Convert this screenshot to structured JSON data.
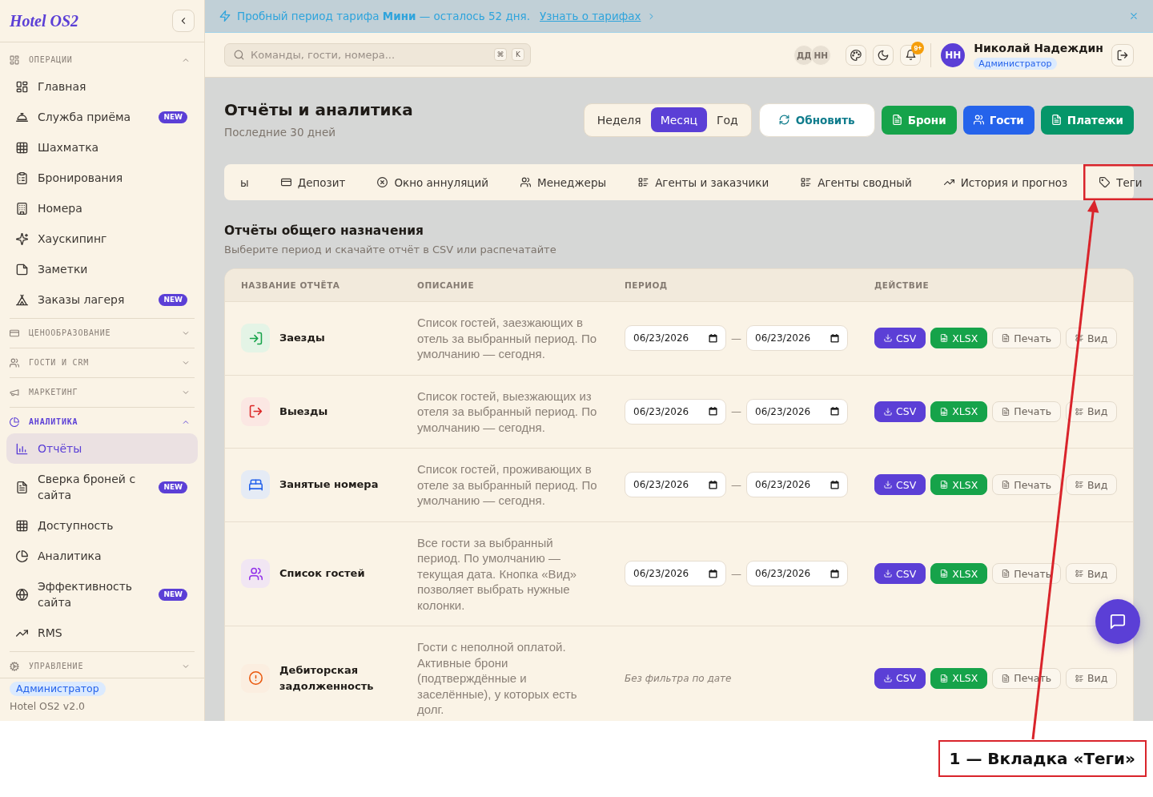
{
  "sidebar": {
    "logo": "Hotel OS2",
    "sections": [
      {
        "title": "ОПЕРАЦИИ",
        "expanded": true,
        "active": false,
        "items": [
          {
            "label": "Главная",
            "selected": false
          },
          {
            "label": "Служба приёма",
            "badge": "NEW",
            "selected": false
          },
          {
            "label": "Шахматка",
            "selected": false
          },
          {
            "label": "Бронирования",
            "selected": false
          },
          {
            "label": "Номера",
            "selected": false
          },
          {
            "label": "Хаускипинг",
            "selected": false
          },
          {
            "label": "Заметки",
            "selected": false
          },
          {
            "label": "Заказы лагеря",
            "badge": "NEW",
            "selected": false
          }
        ]
      },
      {
        "title": "ЦЕНООБРАЗОВАНИЕ",
        "expanded": false,
        "active": false
      },
      {
        "title": "ГОСТИ И CRM",
        "expanded": false,
        "active": false
      },
      {
        "title": "МАРКЕТИНГ",
        "expanded": false,
        "active": false
      },
      {
        "title": "АНАЛИТИКА",
        "expanded": true,
        "active": true,
        "items": [
          {
            "label": "Отчёты",
            "selected": true
          },
          {
            "label": "Сверка броней с сайта",
            "badge": "NEW",
            "selected": false
          },
          {
            "label": "Доступность",
            "selected": false
          },
          {
            "label": "Аналитика",
            "selected": false
          },
          {
            "label": "Эффективность сайта",
            "badge": "NEW",
            "selected": false
          },
          {
            "label": "RMS",
            "selected": false
          }
        ]
      },
      {
        "title": "УПРАВЛЕНИЕ",
        "expanded": false,
        "active": false
      }
    ],
    "footer": {
      "role": "Администратор",
      "version": "Hotel OS2 v2.0"
    }
  },
  "banner": {
    "text": "Пробный период тарифа **Мини** — осталось 52 дня.",
    "link": "Узнать о тарифах"
  },
  "topbar": {
    "search": {
      "placeholder": "Команды, гости, номера..."
    },
    "shortcut": [
      "⌘",
      "K"
    ],
    "presence": [
      "ДД",
      "НН"
    ],
    "notifications": "9+",
    "user": {
      "initials": "НН",
      "name": "Николай Надеждин",
      "role": "Администратор"
    }
  },
  "page": {
    "title": "Отчёты и аналитика",
    "subtitle": "Последние 30 дней",
    "periods": [
      {
        "label": "Неделя",
        "selected": false
      },
      {
        "label": "Месяц",
        "selected": true
      },
      {
        "label": "Год",
        "selected": false
      }
    ],
    "refresh": "Обновить",
    "actions": [
      {
        "label": "Брони",
        "color": "#16a34a"
      },
      {
        "label": "Гости",
        "color": "#2563eb"
      },
      {
        "label": "Платежи",
        "color": "#059669"
      }
    ]
  },
  "tabs": [
    {
      "label": "ы",
      "selected": false,
      "highlighted": false
    },
    {
      "label": "Депозит",
      "selected": false,
      "highlighted": false
    },
    {
      "label": "Окно аннуляций",
      "selected": false,
      "highlighted": false
    },
    {
      "label": "Менеджеры",
      "selected": false,
      "highlighted": false
    },
    {
      "label": "Агенты и заказчики",
      "selected": false,
      "highlighted": false
    },
    {
      "label": "Агенты сводный",
      "selected": false,
      "highlighted": false
    },
    {
      "label": "История и прогноз",
      "selected": false,
      "highlighted": false
    },
    {
      "label": "Теги",
      "selected": false,
      "highlighted": true
    }
  ],
  "section": {
    "title": "Отчёты общего назначения",
    "subtitle": "Выберите период и скачайте отчёт в CSV или распечатайте"
  },
  "table": {
    "columns": [
      "НАЗВАНИЕ ОТЧЁТА",
      "ОПИСАНИЕ",
      "ПЕРИОД",
      "ДЕЙСТВИЕ"
    ],
    "rows": [
      {
        "name": "Заезды",
        "description": "Список гостей, заезжающих в отель за выбранный период. По умолчанию — сегодня.",
        "period": {
          "from": "06/23/2026",
          "separator": "—",
          "to": "06/23/2026"
        },
        "actions": [
          {
            "label": "CSV",
            "kind": "csv"
          },
          {
            "label": "XLSX",
            "kind": "xlsx"
          },
          {
            "label": "Печать",
            "kind": "print"
          },
          {
            "label": "Вид",
            "kind": "view"
          }
        ]
      },
      {
        "name": "Выезды",
        "description": "Список гостей, выезжающих из отеля за выбранный период. По умолчанию — сегодня.",
        "period": {
          "from": "06/23/2026",
          "separator": "—",
          "to": "06/23/2026"
        },
        "actions": [
          {
            "label": "CSV",
            "kind": "csv"
          },
          {
            "label": "XLSX",
            "kind": "xlsx"
          },
          {
            "label": "Печать",
            "kind": "print"
          },
          {
            "label": "Вид",
            "kind": "view"
          }
        ]
      },
      {
        "name": "Занятые номера",
        "description": "Список гостей, проживающих в отеле за выбранный период. По умолчанию — сегодня.",
        "period": {
          "from": "06/23/2026",
          "separator": "—",
          "to": "06/23/2026"
        },
        "actions": [
          {
            "label": "CSV",
            "kind": "csv"
          },
          {
            "label": "XLSX",
            "kind": "xlsx"
          },
          {
            "label": "Печать",
            "kind": "print"
          },
          {
            "label": "Вид",
            "kind": "view"
          }
        ]
      },
      {
        "name": "Список гостей",
        "description": "Все гости за выбранный период. По умолчанию — текущая дата. Кнопка «Вид» позволяет выбрать нужные колонки.",
        "period": {
          "from": "06/23/2026",
          "separator": "—",
          "to": "06/23/2026"
        },
        "actions": [
          {
            "label": "CSV",
            "kind": "csv"
          },
          {
            "label": "XLSX",
            "kind": "xlsx"
          },
          {
            "label": "Печать",
            "kind": "print"
          },
          {
            "label": "Вид",
            "kind": "view"
          }
        ]
      },
      {
        "name": "Дебиторская задолженность",
        "description": "Гости с неполной оплатой. Активные брони (подтверждённые и заселённые), у которых есть долг.",
        "period_note": "Без фильтра по дате",
        "actions": [
          {
            "label": "CSV",
            "kind": "csv"
          },
          {
            "label": "XLSX",
            "kind": "xlsx"
          },
          {
            "label": "Печать",
            "kind": "print"
          },
          {
            "label": "Вид",
            "kind": "view"
          }
        ]
      }
    ]
  },
  "annotation": {
    "label": "1 — Вкладка «Теги»"
  }
}
